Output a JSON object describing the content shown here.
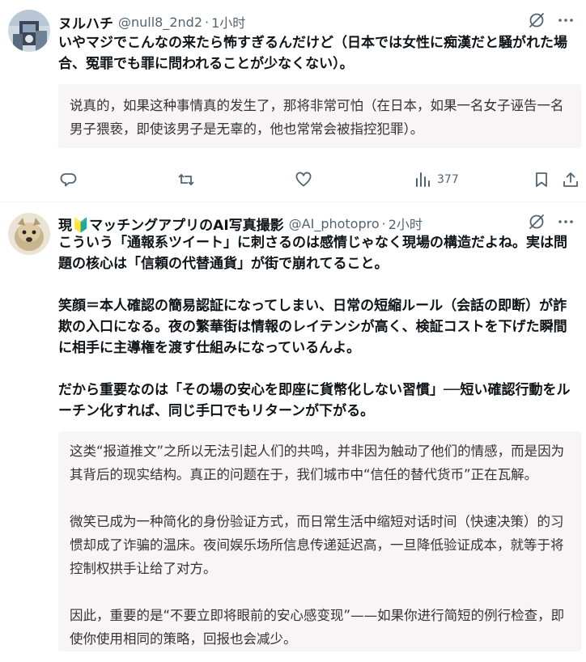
{
  "tweets": [
    {
      "name": "ヌルハチ",
      "handle": "@null8_2nd2",
      "separator": "·",
      "time": "1小时",
      "body": [
        "いやマジでこんなの来たら怖すぎるんだけど（日本では女性に痴漢だと騒がれた場合、冤罪でも罪に問われることが少なくない）。"
      ],
      "translation": [
        "说真的，如果这种事情真的发生了，那将非常可怕（在日本，如果一名女子诬告一名男子猥亵，即使该男子是无辜的，他也常常会被指控犯罪）。"
      ],
      "actions": {
        "views": "377"
      },
      "icons": [
        "grok-icon",
        "more-icon",
        "reply-icon",
        "retweet-icon",
        "like-icon",
        "views-icon",
        "bookmark-icon",
        "share-icon"
      ]
    },
    {
      "name": "現🔰マッチングアプリのAI写真撮影",
      "handle": "@AI_photopro",
      "separator": "·",
      "time": "2小时",
      "body": [
        "こういう「通報系ツイート」に刺さるのは感情じゃなく現場の構造だよね。実は問題の核心は「信頼の代替通貨」が街で崩れてること。",
        "笑顔＝本人確認の簡易認証になってしまい、日常の短縮ルール（会話の即断）が詐欺の入口になる。夜の繁華街は情報のレイテンシが高く、検証コストを下げた瞬間に相手に主導権を渡す仕組みになっているんよ。",
        "だから重要なのは「その場の安心を即座に貨幣化しない習慣」──短い確認行動をルーチン化すれば、同じ手口でもリターンが下がる。"
      ],
      "translation": [
        "这类“报道推文”之所以无法引起人们的共鸣，并非因为触动了他们的情感，而是因为其背后的现实结构。真正的问题在于，我们城市中“信任的替代货币”正在瓦解。",
        "微笑已成为一种简化的身份验证方式，而日常生活中缩短对话时间（快速决策）的习惯却成了诈骗的温床。夜间娱乐场所信息传递延迟高，一旦降低验证成本，就等于将控制权拱手让给了对方。",
        "因此，重要的是“不要立即将眼前的安心感变现”——如果你进行简短的例行检查，即使你使用相同的策略，回报也会减少。"
      ],
      "icons": [
        "grok-icon",
        "more-icon"
      ]
    }
  ],
  "colors": {
    "text": "#0f1419",
    "secondary": "#536471",
    "translation_bg": "#f7f5f5",
    "divider": "#eff3f4"
  }
}
